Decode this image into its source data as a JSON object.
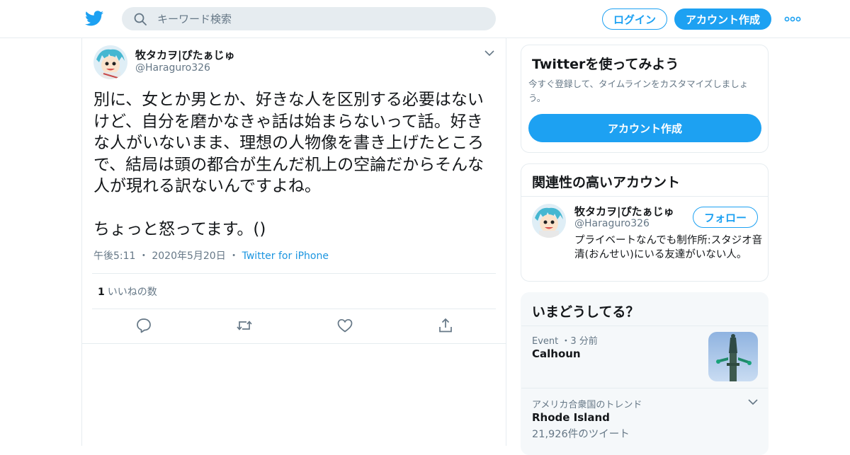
{
  "header": {
    "logo_icon": "twitter-bird-icon",
    "search_placeholder": "キーワード検索",
    "login_label": "ログイン",
    "signup_label": "アカウント作成",
    "more_icon": "more-dots-icon",
    "brand_color": "#1da1f2"
  },
  "tweet": {
    "author_name": "牧タカヲ|ぴたぁじゅ",
    "author_handle": "@Haraguro326",
    "text": "別に、女とか男とか、好きな人を区別する必要はないけど、自分を磨かなきゃ話は始まらないって話。好きな人がいないまま、理想の人物像を書き上げたところで、結局は頭の都合が生んだ机上の空論だからそんな人が現れる訳ないんですよね。\n\nちょっと怒ってます。()",
    "time": "午後5:11",
    "date": "2020年5月20日",
    "source": "Twitter for iPhone",
    "likes_count": "1",
    "likes_label": "いいねの数"
  },
  "sidebar": {
    "signup_card": {
      "title": "Twitterを使ってみよう",
      "description": "今すぐ登録して、タイムラインをカスタマイズしましょう。",
      "button_label": "アカウント作成"
    },
    "related_card": {
      "title": "関連性の高いアカウント",
      "name": "牧タカヲ|ぴたぁじゅ",
      "handle": "@Haraguro326",
      "follow_label": "フォロー",
      "bio": "プライベートなんでも制作所:スタジオ音清(おんせい)にいる友達がいない人。"
    },
    "trends_card": {
      "title": "いまどうしてる？",
      "trends": [
        {
          "category": "Event ・3 分前",
          "name": "Calhoun"
        },
        {
          "category": "アメリカ合衆国のトレンド",
          "name": "Rhode Island",
          "count": "21,926件のツイート"
        }
      ]
    }
  }
}
